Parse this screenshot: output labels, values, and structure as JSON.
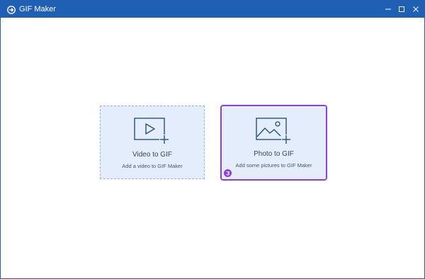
{
  "window": {
    "title": "GIF Maker",
    "titlebar_color": "#1f5fb4",
    "controls": [
      {
        "name": "minimize-icon"
      },
      {
        "name": "maximize-icon"
      },
      {
        "name": "close-icon"
      }
    ]
  },
  "cards": {
    "video": {
      "icon": "video-add-icon",
      "title": "Video to GIF",
      "subtitle": "Add a video to GIF Maker"
    },
    "photo": {
      "icon": "image-add-icon",
      "title": "Photo to GIF",
      "subtitle": "Add some pictures to GIF Maker",
      "selected": true,
      "highlight_color": "#8b3fe0"
    }
  },
  "colors": {
    "card_background": "#e3edfb",
    "accent_blue": "#1f5fb4",
    "selection_purple": "#8b3fe0"
  }
}
